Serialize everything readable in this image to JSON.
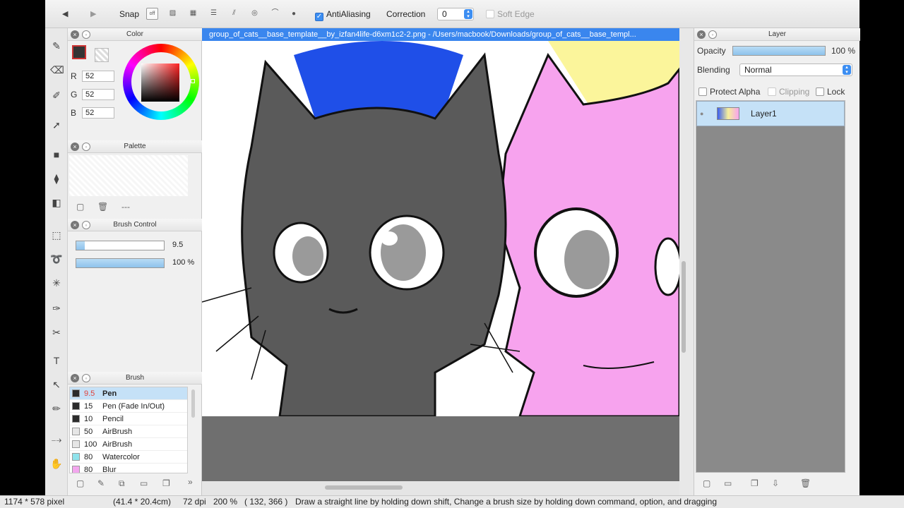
{
  "toolbar": {
    "snap_label": "Snap",
    "antialias_label": "AntiAliasing",
    "antialias_checked": true,
    "correction_label": "Correction",
    "correction_value": "0",
    "soft_edge_label": "Soft Edge",
    "snap_off_label": "off"
  },
  "color_panel": {
    "title": "Color",
    "r_label": "R",
    "r_value": "52",
    "g_label": "G",
    "g_value": "52",
    "b_label": "B",
    "b_value": "52",
    "current_color": "#343434"
  },
  "palette_panel": {
    "title": "Palette",
    "placeholder": "---"
  },
  "brush_control": {
    "title": "Brush Control",
    "size_value": "9.5",
    "opacity_value": "100 %",
    "size_fraction": 0.1,
    "opacity_fraction": 1.0
  },
  "brush_panel": {
    "title": "Brush",
    "items": [
      {
        "size": "9.5",
        "name": "Pen",
        "color": "#2b2b2b",
        "selected": true
      },
      {
        "size": "15",
        "name": "Pen (Fade In/Out)",
        "color": "#2b2b2b",
        "selected": false
      },
      {
        "size": "10",
        "name": "Pencil",
        "color": "#2b2b2b",
        "selected": false
      },
      {
        "size": "50",
        "name": "AirBrush",
        "color": "#e6e6e6",
        "selected": false
      },
      {
        "size": "100",
        "name": "AirBrush",
        "color": "#e6e6e6",
        "selected": false
      },
      {
        "size": "80",
        "name": "Watercolor",
        "color": "#8fe3ec",
        "selected": false
      },
      {
        "size": "80",
        "name": "Blur",
        "color": "#f3a6ee",
        "selected": false
      }
    ]
  },
  "canvas": {
    "doc_title": "group_of_cats__base_template__by_izfan4life-d6xm1c2-2.png - /Users/macbook/Downloads/group_of_cats__base_templ..."
  },
  "layer_panel": {
    "title": "Layer",
    "opacity_label": "Opacity",
    "opacity_value": "100 %",
    "opacity_fraction": 1.0,
    "blending_label": "Blending",
    "blending_value": "Normal",
    "protect_alpha_label": "Protect Alpha",
    "clipping_label": "Clipping",
    "lock_label": "Lock",
    "layers": [
      {
        "name": "Layer1"
      }
    ]
  },
  "status_bar": {
    "size": "1174 * 578 pixel",
    "physical": "(41.4 * 20.4cm)",
    "dpi": "72 dpi",
    "zoom": "200 %",
    "cursor": "( 132, 366 )",
    "hint": "Draw a straight line by holding down shift, Change a brush size by holding down command, option, and dragging"
  },
  "colors": {
    "accent": "#3a86ee",
    "cat_gray": "#5a5a5a",
    "cat_blue": "#1f4fe8",
    "cat_pink": "#f7a3ee",
    "cat_yellow": "#fbf59b"
  }
}
